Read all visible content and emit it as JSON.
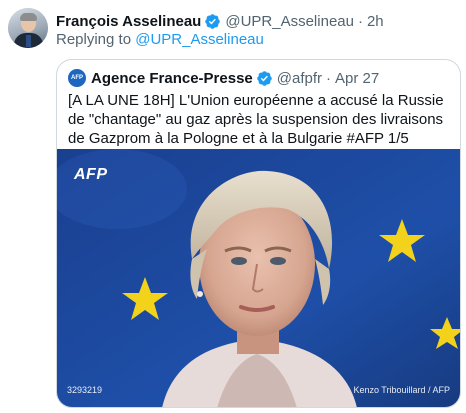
{
  "tweet": {
    "author_name": "François Asselineau",
    "author_handle": "@UPR_Asselineau",
    "separator": "·",
    "time": "2h",
    "replying_prefix": "Replying to",
    "replying_to": "@UPR_Asselineau"
  },
  "quoted": {
    "logo_text": "AFP",
    "author_name": "Agence France-Presse",
    "author_handle": "@afpfr",
    "separator": "·",
    "time": "Apr 27",
    "text": "[A LA UNE 18H] L'Union européenne a accusé la Russie de \"chantage\" au gaz après la suspension des livraisons de Gazprom à la Pologne et à la Bulgarie #AFP 1/5",
    "photo": {
      "watermark": "AFP",
      "photo_id": "3293219",
      "credit": "Kenzo Tribouillard / AFP"
    }
  },
  "colors": {
    "link": "#1d9bf0",
    "secondary_text": "#536471",
    "border": "#cfd9de",
    "eu_blue": "#1e4fa8",
    "eu_star": "#f2d21b"
  },
  "icons": {
    "verified": "verified-badge-icon",
    "avatar": "user-avatar"
  }
}
